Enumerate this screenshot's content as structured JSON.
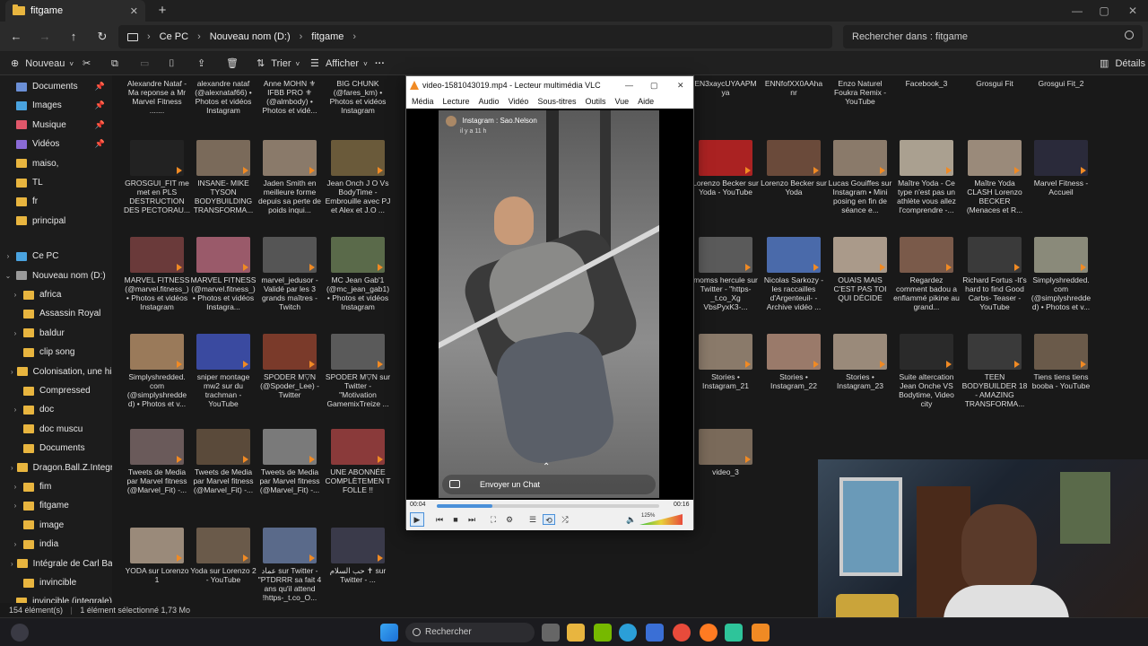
{
  "window": {
    "tab_title": "fitgame",
    "new_tab": "+"
  },
  "address": {
    "crumbs": [
      "Ce PC",
      "Nouveau nom (D:)",
      "fitgame"
    ],
    "search_placeholder": "Rechercher dans : fitgame"
  },
  "commands": {
    "new": "Nouveau",
    "sort": "Trier",
    "view": "Afficher",
    "more": "···",
    "details": "Détails"
  },
  "sidebar": [
    {
      "label": "Documents",
      "icon": "documents-icon",
      "color": "#6b8fd6",
      "pin": true
    },
    {
      "label": "Images",
      "icon": "images-icon",
      "color": "#4aa3df",
      "pin": true
    },
    {
      "label": "Musique",
      "icon": "music-icon",
      "color": "#e0576a",
      "pin": true
    },
    {
      "label": "Vidéos",
      "icon": "videos-icon",
      "color": "#8a6ad6",
      "pin": true
    },
    {
      "label": "maiso,",
      "icon": "folder-icon",
      "color": "#e8b53f"
    },
    {
      "label": "TL",
      "icon": "folder-icon",
      "color": "#e8b53f"
    },
    {
      "label": "fr",
      "icon": "folder-icon",
      "color": "#e8b53f"
    },
    {
      "label": "principal",
      "icon": "folder-icon",
      "color": "#e8b53f"
    },
    {
      "label": "Ce PC",
      "icon": "pc-icon",
      "color": "#4aa3df",
      "gap": true,
      "chev": true
    },
    {
      "label": "Nouveau nom (D:)",
      "icon": "drive-icon",
      "color": "#999999",
      "chev": true,
      "open": true
    },
    {
      "label": "africa",
      "icon": "folder-icon",
      "color": "#e8b53f",
      "chev": true,
      "sub": true
    },
    {
      "label": "Assassin Royal",
      "icon": "folder-icon",
      "color": "#e8b53f",
      "sub": true
    },
    {
      "label": "baldur",
      "icon": "folder-icon",
      "color": "#e8b53f",
      "chev": true,
      "sub": true
    },
    {
      "label": "clip song",
      "icon": "folder-icon",
      "color": "#e8b53f",
      "sub": true
    },
    {
      "label": "Colonisation, une hist",
      "icon": "folder-icon",
      "color": "#e8b53f",
      "chev": true,
      "sub": true
    },
    {
      "label": "Compressed",
      "icon": "folder-icon",
      "color": "#e8b53f",
      "sub": true
    },
    {
      "label": "doc",
      "icon": "folder-icon",
      "color": "#e8b53f",
      "chev": true,
      "sub": true
    },
    {
      "label": "doc muscu",
      "icon": "folder-icon",
      "color": "#e8b53f",
      "sub": true
    },
    {
      "label": "Documents",
      "icon": "folder-icon",
      "color": "#e8b53f",
      "sub": true
    },
    {
      "label": "Dragon.Ball.Z.Integral",
      "icon": "folder-icon",
      "color": "#e8b53f",
      "chev": true,
      "sub": true
    },
    {
      "label": "fim",
      "icon": "folder-icon",
      "color": "#e8b53f",
      "chev": true,
      "sub": true
    },
    {
      "label": "fitgame",
      "icon": "folder-icon",
      "color": "#e8b53f",
      "chev": true,
      "sub": true
    },
    {
      "label": "image",
      "icon": "folder-icon",
      "color": "#e8b53f",
      "sub": true
    },
    {
      "label": "india",
      "icon": "folder-icon",
      "color": "#e8b53f",
      "chev": true,
      "sub": true
    },
    {
      "label": "Intégrale de Carl Bark",
      "icon": "folder-icon",
      "color": "#e8b53f",
      "chev": true,
      "sub": true
    },
    {
      "label": "invincible",
      "icon": "folder-icon",
      "color": "#e8b53f",
      "sub": true
    },
    {
      "label": "invincible (integrale)",
      "icon": "folder-icon",
      "color": "#e8b53f",
      "sub": true
    }
  ],
  "files": [
    {
      "cap": "Alexandre Nataf - Ma reponse a Mr Marvel Fitness .......",
      "c": "#4a4a4a",
      "col": 0,
      "row": 0,
      "top": true
    },
    {
      "cap": "alexandre nataf (@alexnataf66) • Photos et vidéos Instagram",
      "c": "#4a4a4a",
      "col": 1,
      "row": 0,
      "top": true
    },
    {
      "cap": "Anne MOHN ⚜ IFBB PRO ⚜ (@almbody) • Photos et vidé...",
      "c": "#4a4a4a",
      "col": 2,
      "row": 0,
      "top": true
    },
    {
      "cap": "BIG CHUNK (@fares_km) • Photos et vidéos Instagram",
      "c": "#4a4a4a",
      "col": 3,
      "row": 0,
      "top": true
    },
    {
      "cap": "GROSGUI_FIT me met en PLS DESTRUCTION DES PECTORAU...",
      "c": "#222222",
      "col": 0,
      "row": 1
    },
    {
      "cap": "INSANE- MIKE TYSON BODYBUILDING TRANSFORMA...",
      "c": "#7a6a5a",
      "col": 1,
      "row": 1
    },
    {
      "cap": "Jaden Smith en meilleure forme depuis sa perte de poids inqui...",
      "c": "#8a7a6a",
      "col": 2,
      "row": 1
    },
    {
      "cap": "Jean Onch J O Vs BodyTime - Embrouille avec PJ et Alex et J.O ...",
      "c": "#6a5a3a",
      "col": 3,
      "row": 1
    },
    {
      "cap": "MARVEL FITNESS (@marvel.fitness_) • Photos et vidéos Instagram",
      "c": "#6a3a3a",
      "col": 0,
      "row": 2
    },
    {
      "cap": "MARVEL FITNESS (@marvel.fitness_) • Photos et vidéos Instagra...",
      "c": "#9a5a6a",
      "col": 1,
      "row": 2
    },
    {
      "cap": "marvel_jedusor - Validé par les 3 grands maîtres - Twitch",
      "c": "#555555",
      "col": 2,
      "row": 2
    },
    {
      "cap": "MC Jean Gab'1 (@mc_jean_gab1) • Photos et vidéos Instagram",
      "c": "#5a6a4a",
      "col": 3,
      "row": 2
    },
    {
      "cap": "Simplyshredded. com (@simplyshredde d) • Photos et v...",
      "c": "#9a7a5a",
      "col": 0,
      "row": 3
    },
    {
      "cap": "sniper montage mw2 sur du trachman - YouTube",
      "c": "#3a4aa0",
      "col": 1,
      "row": 3
    },
    {
      "cap": "SPODER M▽N (@Spoder_Lee) - Twitter",
      "c": "#7a3a2a",
      "col": 2,
      "row": 3
    },
    {
      "cap": "SPODER M▽N sur Twitter - \"Motivation GamemixTreize ...",
      "c": "#5a5a5a",
      "col": 3,
      "row": 3
    },
    {
      "cap": "Tweets de Media par Marvel fitness (@Marvel_Fit) -...",
      "c": "#6a5a5a",
      "col": 0,
      "row": 4
    },
    {
      "cap": "Tweets de Media par Marvel fitness (@Marvel_Fit) -...",
      "c": "#5a4a3a",
      "col": 1,
      "row": 4
    },
    {
      "cap": "Tweets de Media par Marvel fitness (@Marvel_Fit) -...",
      "c": "#7a7a7a",
      "col": 2,
      "row": 4
    },
    {
      "cap": "UNE ABONNÉE COMPLÈTEMEN T FOLLE !!",
      "c": "#8a3a3a",
      "col": 3,
      "row": 4
    },
    {
      "cap": "YODA sur Lorenzo 1",
      "c": "#9a8a7a",
      "col": 0,
      "row": 5
    },
    {
      "cap": "Yoda sur Lorenzo 2 - YouTube",
      "c": "#6a5a4a",
      "col": 1,
      "row": 5
    },
    {
      "cap": "عماد sur Twitter - \"PTDRRR sa fait 4 ans qu'il attend !https-_t.co_O...",
      "c": "#5a6a8a",
      "col": 2,
      "row": 5
    },
    {
      "cap": "حب السلام ✝ sur Twitter - ...",
      "c": "#3a3a4a",
      "col": 3,
      "row": 5
    },
    {
      "cap": "Lorenzo Becker sur Yoda - YouTube",
      "c": "#aa2222",
      "col": 5,
      "row": 1
    },
    {
      "cap": "Lorenzo Becker sur Yoda",
      "c": "#6a4a3a",
      "col": 6,
      "row": 1
    },
    {
      "cap": "Lucas Gouiffes sur Instagram • Mini posing en fin de séance e...",
      "c": "#8a7a6a",
      "col": 7,
      "row": 1
    },
    {
      "cap": "Maître Yoda - Ce type n'est pas un athlète vous allez l'comprendre -...",
      "c": "#aaa090",
      "col": 8,
      "row": 1
    },
    {
      "cap": "Maître Yoda CLASH Lorenzo BECKER (Menaces et R...",
      "c": "#9a8a7a",
      "col": 9,
      "row": 1
    },
    {
      "cap": "Marvel Fitness - Accueil",
      "c": "#2a2a3a",
      "col": 10,
      "row": 1
    },
    {
      "cap": "momss hercule sur Twitter - \"https-_t.co_Xg VbsPyxK3-...",
      "c": "#5a5a5a",
      "col": 5,
      "row": 2
    },
    {
      "cap": "Nicolas Sarkozy -les raccailles d'Argenteuil- - Archive vidéo ...",
      "c": "#4a6aaa",
      "col": 6,
      "row": 2
    },
    {
      "cap": "OUAIS MAIS C'EST PAS TOI QUI DÉCIDE",
      "c": "#aa9a8a",
      "col": 7,
      "row": 2
    },
    {
      "cap": "Regardez comment badou a enflammé pikine au grand...",
      "c": "#7a5a4a",
      "col": 8,
      "row": 2
    },
    {
      "cap": "Richard Fortus -It's hard to find Good Carbs- Teaser - YouTube",
      "c": "#3a3a3a",
      "col": 9,
      "row": 2
    },
    {
      "cap": "Simplyshredded. com (@simplyshredde d) • Photos et v...",
      "c": "#8a8a7a",
      "col": 10,
      "row": 2
    },
    {
      "cap": "Stories • Instagram_21",
      "c": "#8a7a6a",
      "col": 5,
      "row": 3
    },
    {
      "cap": "Stories • Instagram_22",
      "c": "#9a7a6a",
      "col": 6,
      "row": 3
    },
    {
      "cap": "Stories • Instagram_23",
      "c": "#9a8a7a",
      "col": 7,
      "row": 3
    },
    {
      "cap": "Suite altercation Jean Onche VS Bodytime, Video city",
      "c": "#2a2a2a",
      "col": 8,
      "row": 3
    },
    {
      "cap": "TEEN BODYBUILDER 18 - AMAZING TRANSFORMA...",
      "c": "#3a3a3a",
      "col": 9,
      "row": 3
    },
    {
      "cap": "Tiens tiens tiens booba - YouTube",
      "c": "#6a5a4a",
      "col": 10,
      "row": 3
    },
    {
      "cap": "video_3",
      "c": "#7a6a5a",
      "col": 5,
      "row": 4
    },
    {
      "cap": "Facebook_3",
      "c": "#3a3a3a",
      "col": 8,
      "row": 0,
      "top": true
    },
    {
      "cap": "Grosgui Fit",
      "c": "#3a3a3a",
      "col": 9,
      "row": 0,
      "top": true
    },
    {
      "cap": "Grosgui Fit_2",
      "c": "#3a3a3a",
      "col": 10,
      "row": 0,
      "top": true
    },
    {
      "cap": "Enzo Naturel Foukra Remix - YouTube",
      "c": "#3a3a3a",
      "col": 7,
      "row": 0,
      "top": true
    },
    {
      "cap": "ENNfofXX0AAha nr",
      "c": "#3a3a3a",
      "col": 6,
      "row": 0,
      "top": true
    },
    {
      "cap": "EN3xaycUYAAPM ya",
      "c": "#3a3a3a",
      "col": 5,
      "row": 0,
      "top": true
    }
  ],
  "status": {
    "count": "154 élément(s)",
    "selected": "1 élément sélectionné  1,73 Mo"
  },
  "taskbar": {
    "search": "Rechercher"
  },
  "vlc": {
    "title": "video-1581043019.mp4 - Lecteur multimédia VLC",
    "menu": [
      "Média",
      "Lecture",
      "Audio",
      "Vidéo",
      "Sous-titres",
      "Outils",
      "Vue",
      "Aide"
    ],
    "overlay_user": "Instagram : Sao.Nelson",
    "overlay_time": "il y a 11 h",
    "chat_label": "Envoyer un Chat",
    "time_elapsed": "00:04",
    "time_total": "00:16",
    "progress": 0.25,
    "volume_label": "125%",
    "volume": 1.25
  }
}
